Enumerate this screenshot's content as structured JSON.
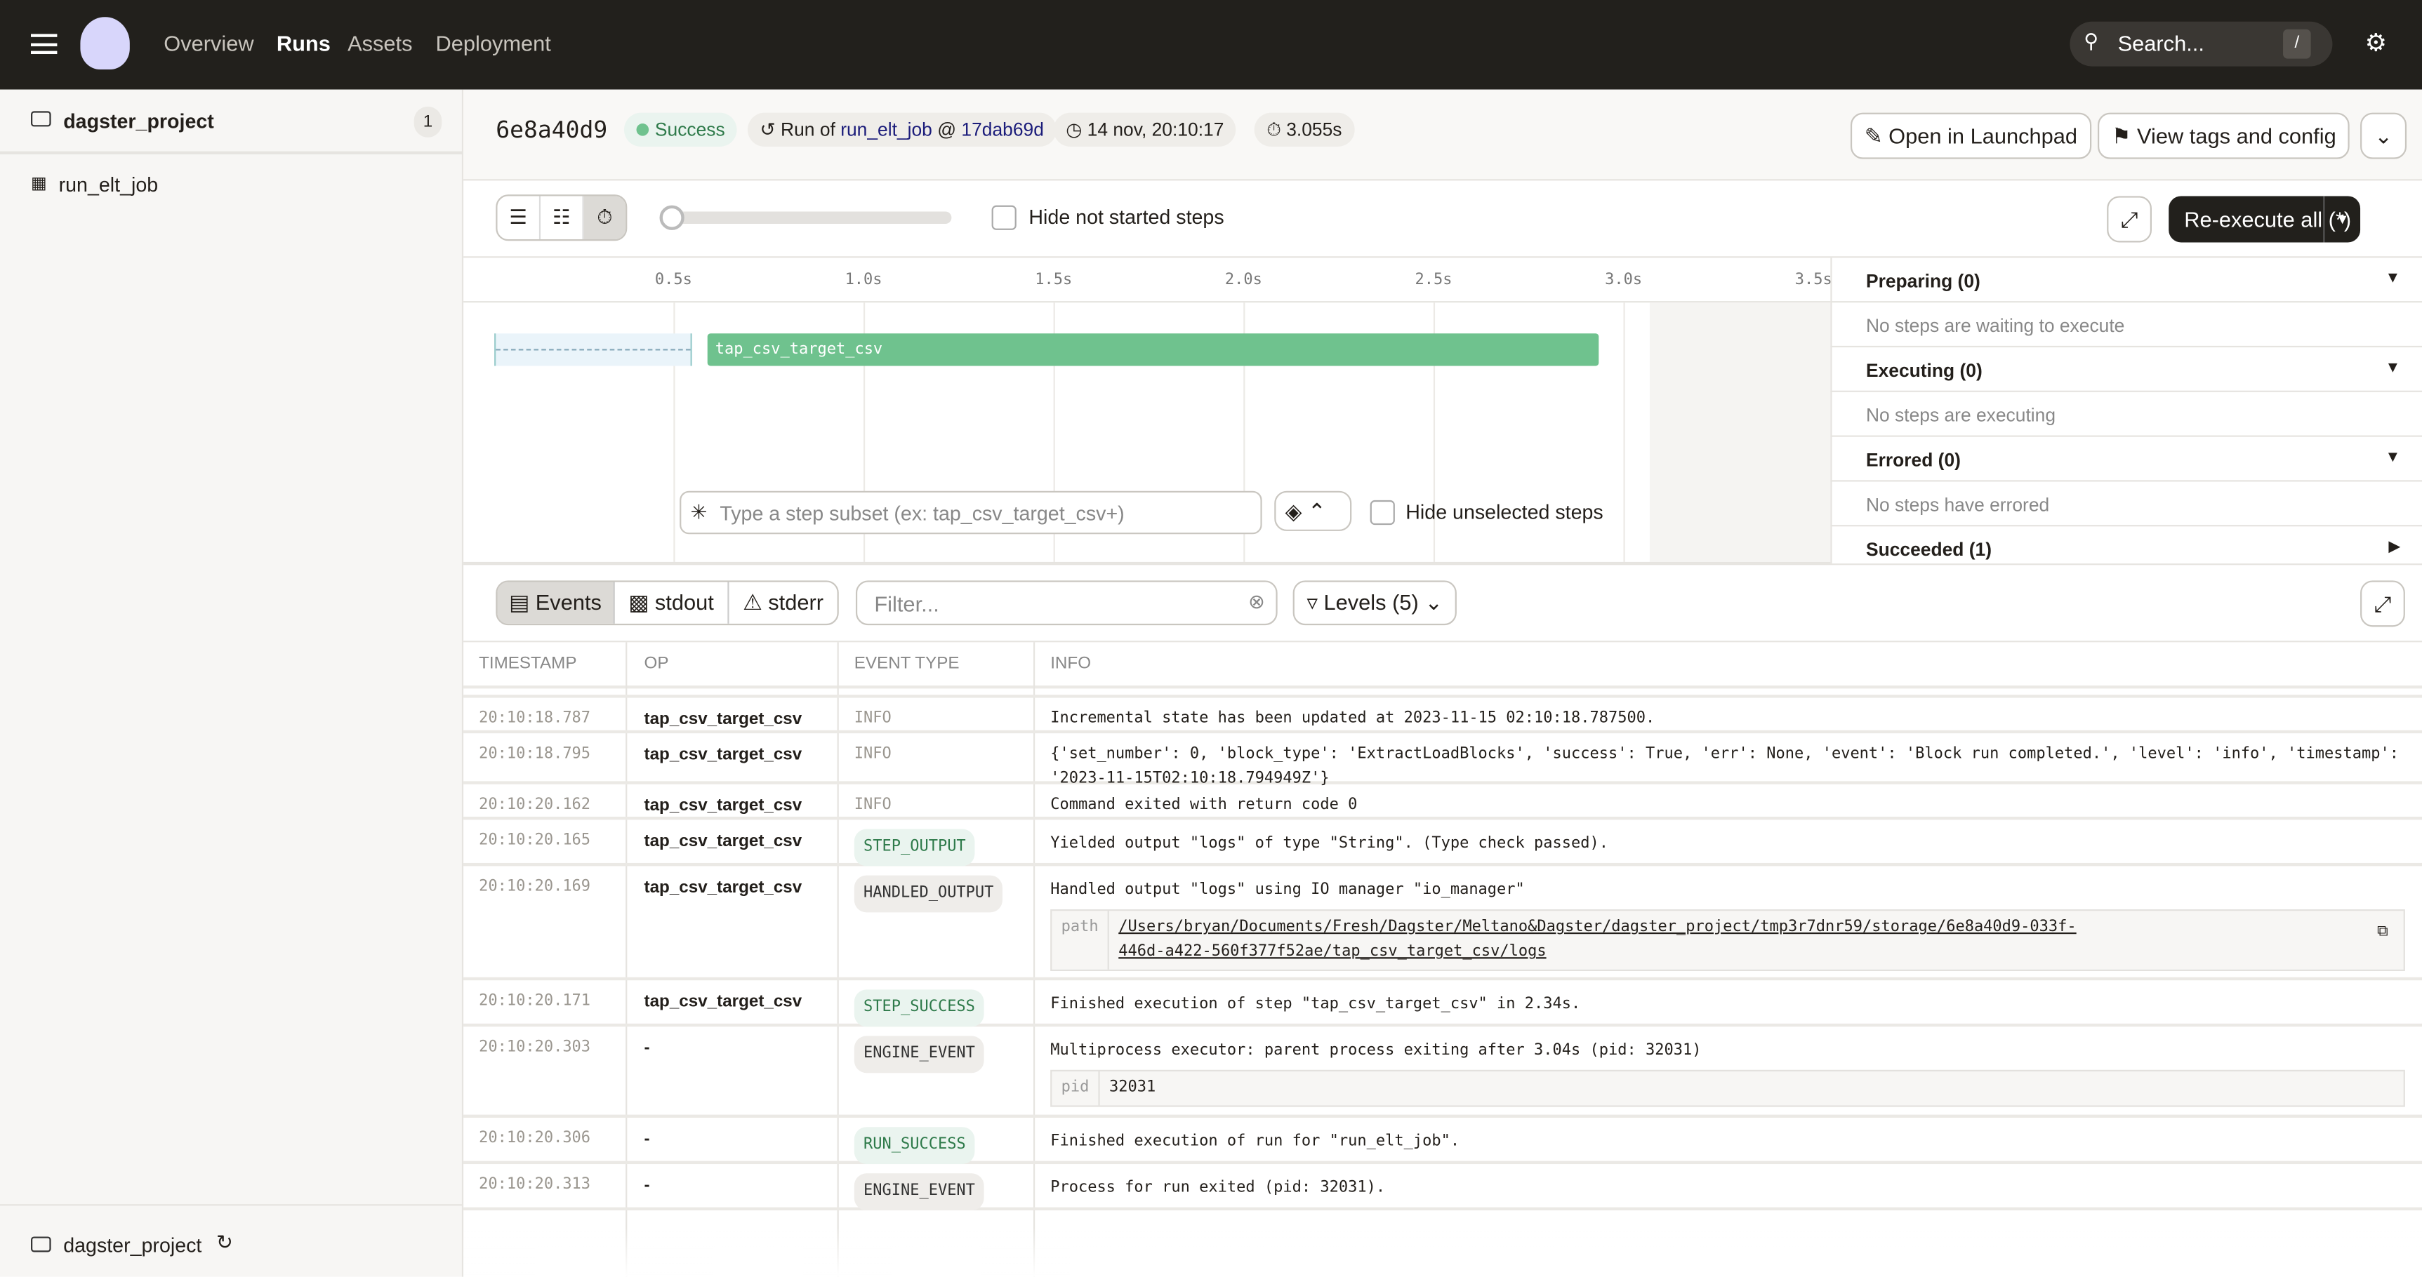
{
  "topnav": {
    "items": [
      "Overview",
      "Runs",
      "Assets",
      "Deployment"
    ],
    "active": "Runs",
    "search_placeholder": "Search...",
    "search_shortcut": "/"
  },
  "sidebar": {
    "project": "dagster_project",
    "project_count": "1",
    "job": "run_elt_job",
    "footer_project": "dagster_project"
  },
  "run": {
    "id": "6e8a40d9",
    "status": "Success",
    "run_of_prefix": "Run of",
    "job": "run_elt_job",
    "at": "@",
    "snapshot": "17dab69d",
    "started": "14 nov, 20:10:17",
    "duration": "3.055s"
  },
  "actions": {
    "launchpad": "Open in Launchpad",
    "tags": "View tags and config",
    "reexecute": "Re-execute all (*)"
  },
  "toolbar": {
    "hide_not_started": "Hide not started steps"
  },
  "gantt": {
    "ticks": [
      "0.5s",
      "1.0s",
      "1.5s",
      "2.0s",
      "2.5s",
      "3.0s",
      "3.5s"
    ],
    "step": "tap_csv_target_csv",
    "subset_placeholder": "Type a step subset (ex: tap_csv_target_csv+)",
    "hide_unselected": "Hide unselected steps"
  },
  "steps_panel": [
    {
      "title": "Preparing (0)",
      "empty": "No steps are waiting to execute"
    },
    {
      "title": "Executing (0)",
      "empty": "No steps are executing"
    },
    {
      "title": "Errored (0)",
      "empty": "No steps have errored"
    },
    {
      "title": "Succeeded (1)",
      "empty": ""
    }
  ],
  "logs": {
    "tabs": [
      "Events",
      "stdout",
      "stderr"
    ],
    "filter_placeholder": "Filter...",
    "levels": "Levels (5)",
    "columns": [
      "TIMESTAMP",
      "OP",
      "EVENT TYPE",
      "INFO"
    ],
    "rows": [
      {
        "ts": "20:10:18.787",
        "op": "tap_csv_target_csv",
        "type": "INFO",
        "info": "Incremental state has been updated at 2023-11-15 02:10:18.787500."
      },
      {
        "ts": "20:10:18.795",
        "op": "tap_csv_target_csv",
        "type": "INFO",
        "info": "{'set_number': 0, 'block_type': 'ExtractLoadBlocks', 'success': True, 'err': None, 'event': 'Block run completed.', 'level': 'info', 'timestamp': '2023-11-15T02:10:18.794949Z'}"
      },
      {
        "ts": "20:10:20.162",
        "op": "tap_csv_target_csv",
        "type": "INFO",
        "info": "Command exited with return code 0"
      },
      {
        "ts": "20:10:20.165",
        "op": "tap_csv_target_csv",
        "type": "STEP_OUTPUT",
        "info": "Yielded output \"logs\" of type \"String\". (Type check passed)."
      },
      {
        "ts": "20:10:20.169",
        "op": "tap_csv_target_csv",
        "type": "HANDLED_OUTPUT",
        "info": "Handled output \"logs\" using IO manager \"io_manager\"",
        "meta_key": "path",
        "meta_val": "/Users/bryan/Documents/Fresh/Dagster/Meltano&Dagster/dagster_project/tmp3r7dnr59/storage/6e8a40d9-033f-446d-a422-560f377f52ae/tap_csv_target_csv/logs"
      },
      {
        "ts": "20:10:20.171",
        "op": "tap_csv_target_csv",
        "type": "STEP_SUCCESS",
        "info": "Finished execution of step \"tap_csv_target_csv\" in 2.34s."
      },
      {
        "ts": "20:10:20.303",
        "op": "-",
        "type": "ENGINE_EVENT",
        "info": "Multiprocess executor: parent process exiting after 3.04s (pid: 32031)",
        "meta_key": "pid",
        "meta_val": "32031"
      },
      {
        "ts": "20:10:20.306",
        "op": "-",
        "type": "RUN_SUCCESS",
        "info": "Finished execution of run for \"run_elt_job\"."
      },
      {
        "ts": "20:10:20.313",
        "op": "-",
        "type": "ENGINE_EVENT",
        "info": "Process for run exited (pid: 32031)."
      }
    ]
  },
  "colors": {
    "success": "#6fc28e",
    "dark": "#22201c",
    "link": "#1b1c7a"
  }
}
